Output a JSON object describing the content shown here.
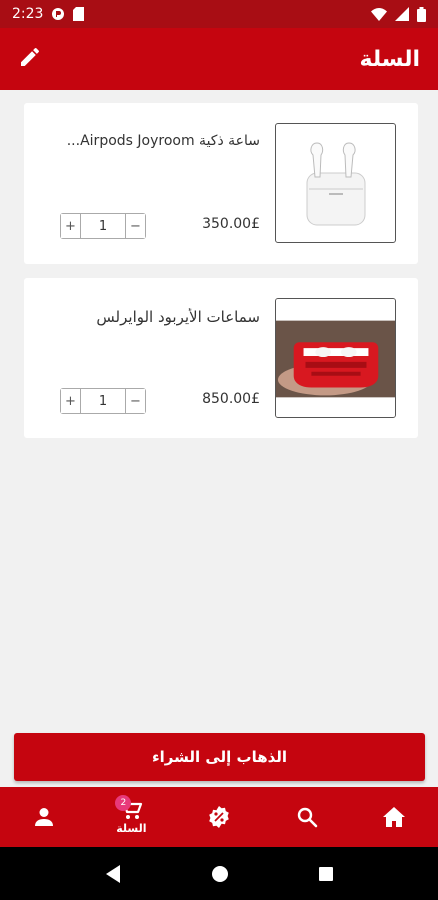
{
  "status": {
    "time": "2:23"
  },
  "header": {
    "title": "السلة"
  },
  "cart": {
    "items": [
      {
        "name": "ساعة ذكية Airpods Joyroom...",
        "price": "350.00£",
        "quantity": "1",
        "plus": "+",
        "minus": "−"
      },
      {
        "name": "سماعات الأيربود الوايرلس",
        "price": "850.00£",
        "quantity": "1",
        "plus": "+",
        "minus": "−"
      }
    ]
  },
  "checkout": {
    "label": "الذهاب إلى الشراء"
  },
  "nav": {
    "cart_label": "السلة",
    "cart_badge": "2",
    "items": [
      "profile-icon",
      "cart-icon",
      "offers-icon",
      "search-icon",
      "home-icon"
    ]
  },
  "colors": {
    "primary": "#c5050f",
    "status": "#a80d14",
    "badge": "#e8397a"
  }
}
